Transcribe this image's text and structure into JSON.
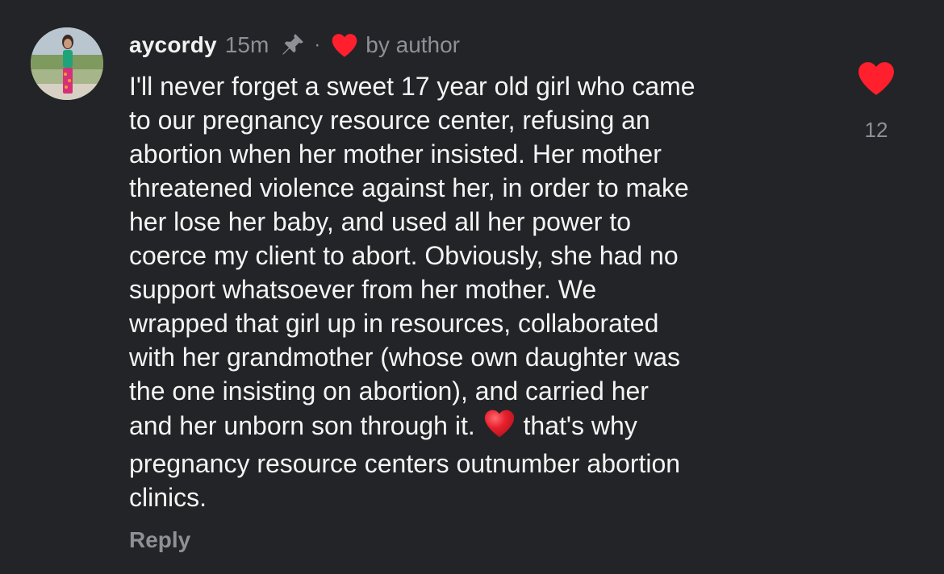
{
  "comment": {
    "username": "aycordy",
    "time": "15m",
    "separator": "·",
    "author_badge": "by author",
    "text_before_emoji": "I'll never forget a sweet 17 year old girl who came\nto our pregnancy resource center, refusing an\nabortion when her mother insisted. Her mother\nthreatened violence against her, in order to make\nher lose her baby, and used all her power to\ncoerce my client to abort. Obviously, she had no\nsupport whatsoever from her mother. We\nwrapped that girl up in resources, collaborated\nwith her grandmother (whose own daughter was\nthe one insisting on abortion), and carried her\nand her unborn son through it. ",
    "inline_emoji": "red-heart",
    "text_after_emoji": " that's why\npregnancy resource centers outnumber abortion\nclinics.",
    "reply_label": "Reply",
    "like_count": "12",
    "pinned": true,
    "liked_by_author": true,
    "liked": true
  },
  "icons": {
    "pin": "pin-icon",
    "author_heart": "heart-icon",
    "like": "heart-icon"
  },
  "colors": {
    "background": "#232427",
    "text": "#f4f4f4",
    "muted": "#8e9096",
    "heart": "#ff1f2d"
  }
}
